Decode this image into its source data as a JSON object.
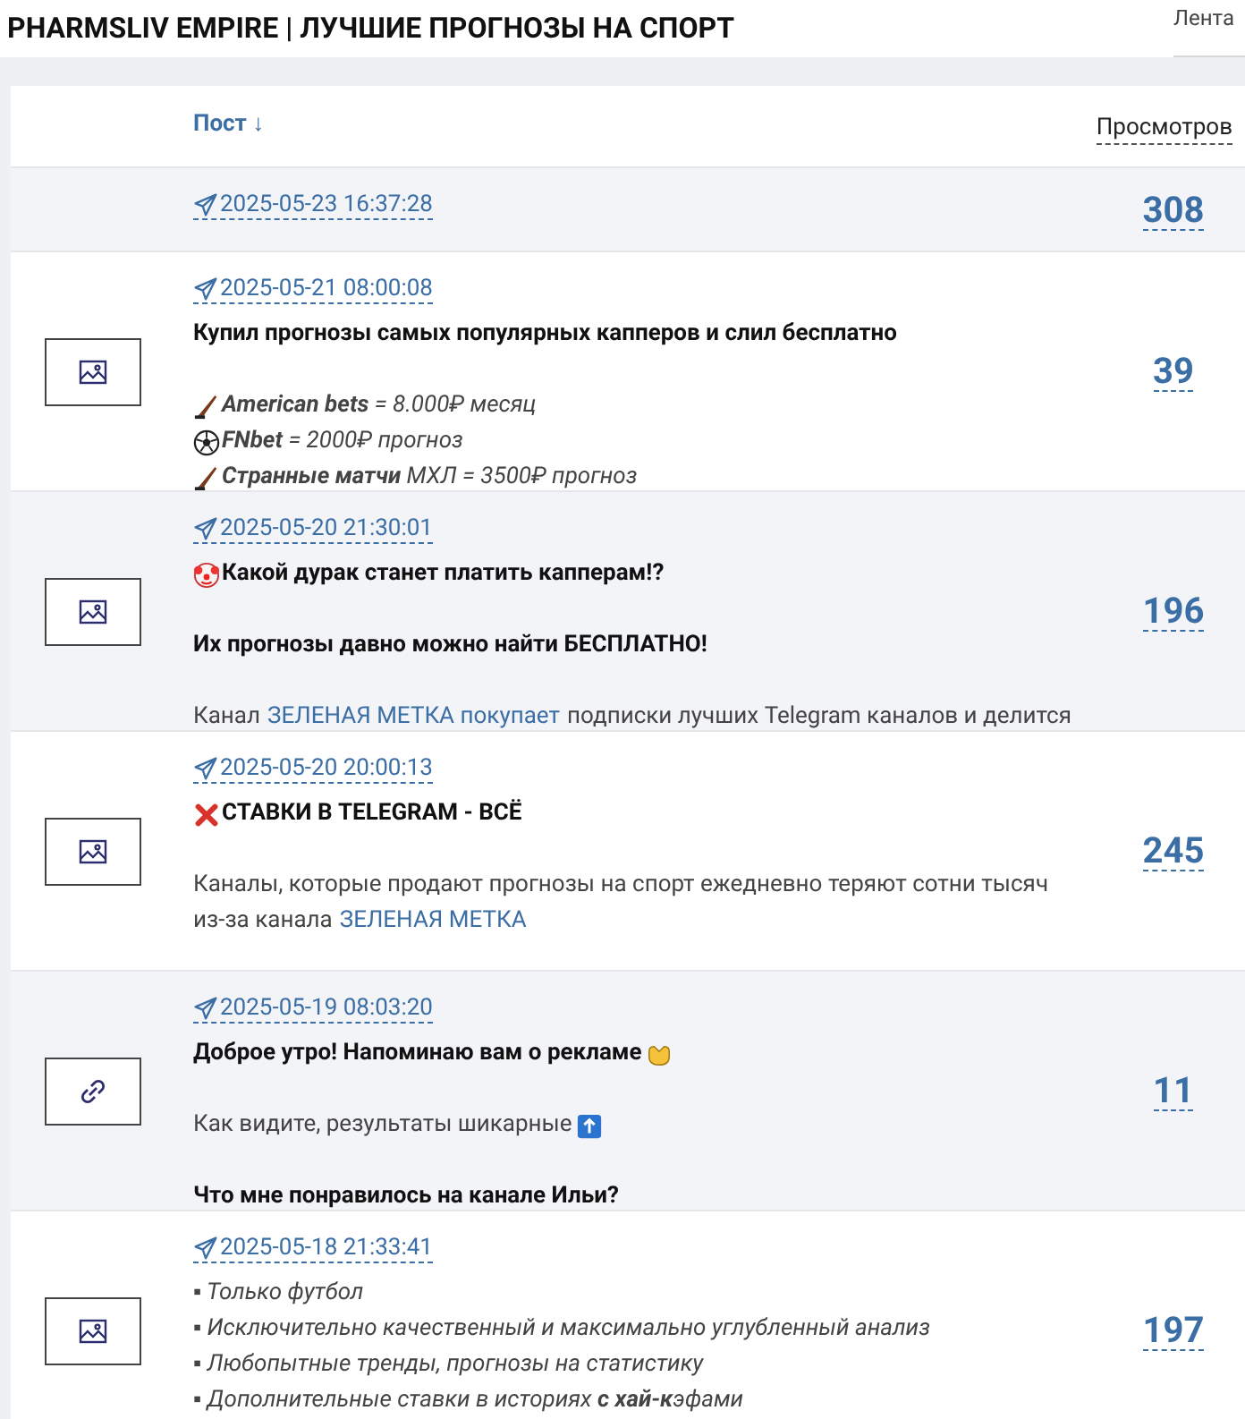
{
  "header": {
    "title": "PHARMSLIV EMPIRE | ЛУЧШИЕ ПРОГНОЗЫ НА СПОРТ",
    "nav_link": "Лента"
  },
  "table": {
    "columns": [
      {
        "label": "Пост ↓",
        "kind": "sort"
      },
      {
        "label": "Просмотров",
        "kind": "dashed"
      }
    ],
    "rows": [
      {
        "kind": "text_post",
        "date": "2025-05-23 16:37:28",
        "views": "308",
        "lines": []
      },
      {
        "kind": "image_post",
        "date": "2025-05-21 08:00:08",
        "views": "39",
        "lines": [
          {
            "kind": "bold",
            "parts": [
              {
                "kind": "text",
                "text": "Купил прогнозы самых популярных капперов и слил бесплатно"
              }
            ]
          },
          {
            "kind": "blank"
          },
          {
            "kind": "italic",
            "parts": [
              {
                "kind": "text",
                "text": "**American bets** = 8.000₽ месяц"
              }
            ]
          },
          {
            "kind": "italic",
            "parts": [
              {
                "kind": "text",
                "text": "**FNbet** = 2000₽ прогноз"
              }
            ]
          },
          {
            "kind": "italic",
            "parts": [
              {
                "kind": "text",
                "text": "**Странные матчи** МХЛ = 3500₽ прогноз"
              }
            ]
          }
        ]
      },
      {
        "kind": "image_post",
        "date": "2025-05-20 21:30:01",
        "views": "196",
        "lines": [
          {
            "kind": "bold",
            "parts": [
              {
                "kind": "text",
                "text": "Какой дурак станет платить капперам!?"
              }
            ]
          },
          {
            "kind": "blank"
          },
          {
            "kind": "bold",
            "parts": [
              {
                "kind": "text",
                "text": "Их прогнозы давно можно найти БЕСПЛАТНО!"
              }
            ]
          },
          {
            "kind": "blank"
          },
          {
            "kind": "plain",
            "parts": [
              {
                "kind": "text",
                "text": "Канал"
              },
              {
                "kind": "link",
                "text": "ЗЕЛЕНАЯ МЕТКА покупает"
              },
              {
                "kind": "text",
                "text": "подписки лучших Telegram каналов и делится"
              }
            ]
          }
        ]
      },
      {
        "kind": "image_post",
        "date": "2025-05-20 20:00:13",
        "views": "245",
        "lines": [
          {
            "kind": "bold",
            "parts": [
              {
                "kind": "text",
                "text": "СТАВКИ В TELEGRAM - ВСЁ"
              }
            ]
          },
          {
            "kind": "blank"
          },
          {
            "kind": "plain",
            "parts": [
              {
                "kind": "text",
                "text": "Каналы, которые продают прогнозы на спорт ежедневно теряют сотни тысяч"
              }
            ]
          },
          {
            "kind": "plain",
            "parts": [
              {
                "kind": "text",
                "text": "из-за канала"
              },
              {
                "kind": "link",
                "text": "ЗЕЛЕНАЯ МЕТКА"
              }
            ]
          }
        ]
      },
      {
        "kind": "link_post",
        "date": "2025-05-19 08:03:20",
        "views": "11",
        "lines": [
          {
            "kind": "bold",
            "parts": [
              {
                "kind": "text",
                "text": "Доброе утро! Напоминаю вам о рекламе"
              }
            ]
          },
          {
            "kind": "blank"
          },
          {
            "kind": "plain",
            "parts": [
              {
                "kind": "text",
                "text": "Как видите, результаты шикарные"
              }
            ]
          },
          {
            "kind": "blank"
          },
          {
            "kind": "bold",
            "parts": [
              {
                "kind": "text",
                "text": "Что мне понравилось на канале Ильи?"
              }
            ]
          }
        ]
      },
      {
        "kind": "image_post",
        "date": "2025-05-18 21:33:41",
        "views": "197",
        "lines": [
          {
            "kind": "italic",
            "parts": [
              {
                "kind": "text",
                "text": "▪ Только футбол"
              }
            ]
          },
          {
            "kind": "italic",
            "parts": [
              {
                "kind": "text",
                "text": "▪ Исключительно качественный и максимально углубленный анализ"
              }
            ]
          },
          {
            "kind": "italic",
            "parts": [
              {
                "kind": "text",
                "text": "▪ Любопытные тренды, прогнозы на статистику"
              }
            ]
          },
          {
            "kind": "italic",
            "parts": [
              {
                "kind": "text",
                "text": "▪ Дополнительные ставки в историях **с хай-к**эфами"
              }
            ]
          }
        ]
      }
    ]
  }
}
